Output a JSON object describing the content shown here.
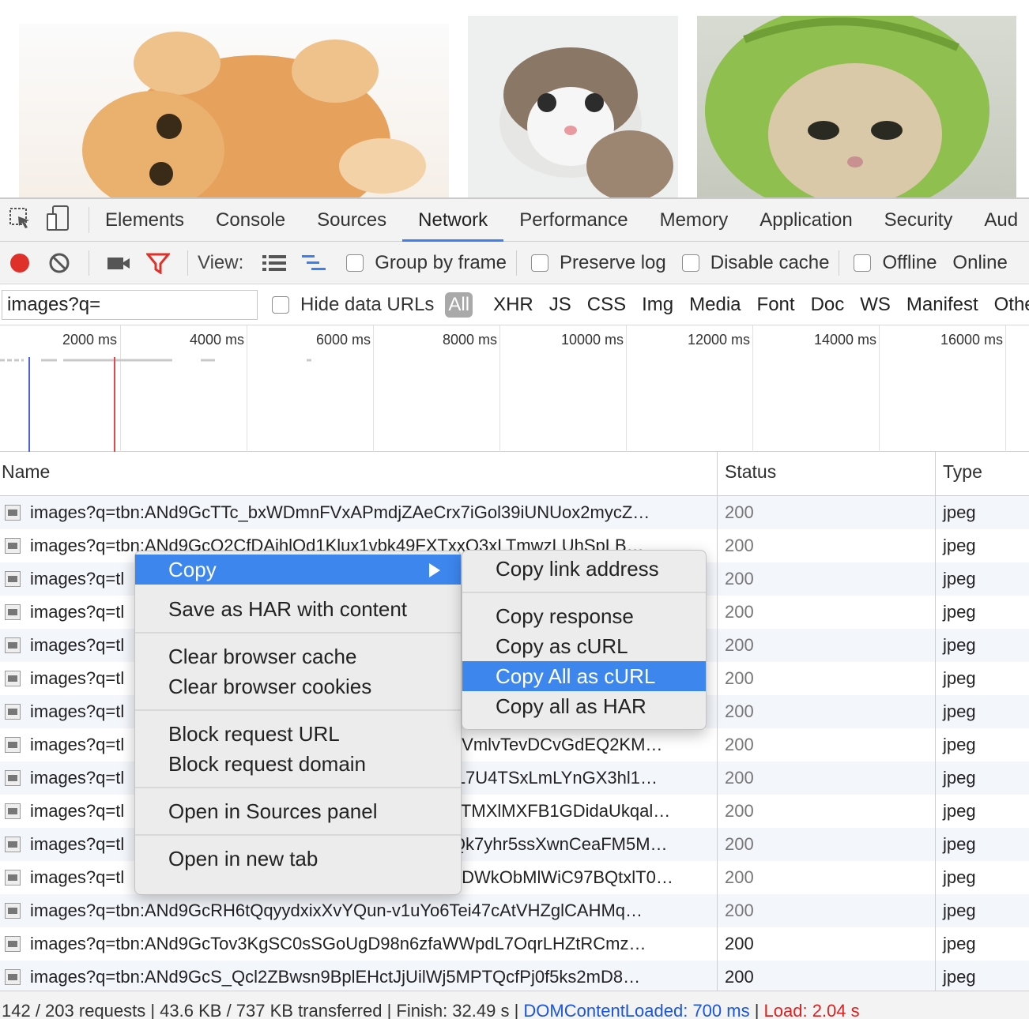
{
  "devtools": {
    "tabs": [
      "Elements",
      "Console",
      "Sources",
      "Network",
      "Performance",
      "Memory",
      "Application",
      "Security",
      "Aud"
    ],
    "active_tab": "Network"
  },
  "toolbar": {
    "view_label": "View:",
    "group_by_frame": "Group by frame",
    "preserve_log": "Preserve log",
    "disable_cache": "Disable cache",
    "offline": "Offline",
    "online": "Online"
  },
  "filter": {
    "value": "images?q=",
    "hide_data_urls": "Hide data URLs",
    "types": [
      "All",
      "XHR",
      "JS",
      "CSS",
      "Img",
      "Media",
      "Font",
      "Doc",
      "WS",
      "Manifest",
      "Othe"
    ]
  },
  "overview": {
    "ticks": [
      "2000 ms",
      "4000 ms",
      "6000 ms",
      "8000 ms",
      "10000 ms",
      "12000 ms",
      "14000 ms",
      "16000 ms"
    ]
  },
  "table": {
    "headers": {
      "name": "Name",
      "status": "Status",
      "type": "Type"
    },
    "rows": [
      {
        "name": "images?q=tbn:ANd9GcTTc_bxWDmnFVxAPmdjZAeCrx7iGol39iUNUox2mycZ…",
        "status": "200",
        "type": "jpeg"
      },
      {
        "name": "images?q=tbn:ANd9GcQ2CfDAjhlOd1Klux1vbk49FXTxxQ3xLTmwzLUhSpLB…",
        "status": "200",
        "type": "jpeg"
      },
      {
        "name": "images?q=tl",
        "status": "200",
        "type": "jpeg"
      },
      {
        "name": "images?q=tl",
        "status": "200",
        "type": "jpeg"
      },
      {
        "name": "images?q=tl",
        "status": "200",
        "type": "jpeg"
      },
      {
        "name": "images?q=tl",
        "status": "200",
        "type": "jpeg"
      },
      {
        "name": "images?q=tl",
        "status": "200",
        "type": "jpeg"
      },
      {
        "name": "images?q=tl",
        "tail": "A3VmlvTevDCvGdEQ2KM…",
        "status": "200",
        "type": "jpeg"
      },
      {
        "name": "images?q=tl",
        "tail": "jAL7U4TSxLmLYnGX3hl1…",
        "status": "200",
        "type": "jpeg"
      },
      {
        "name": "images?q=tl",
        "tail": "nZTMXlMXFB1GDidaUkqal…",
        "status": "200",
        "type": "jpeg"
      },
      {
        "name": "images?q=tl",
        "tail": "AQk7yhr5ssXwnCeaFM5M…",
        "status": "200",
        "type": "jpeg"
      },
      {
        "name": "images?q=tl",
        "tail": "NvDWkObMlWiC97BQtxlT0…",
        "status": "200",
        "type": "jpeg"
      },
      {
        "name": "images?q=tbn:ANd9GcRH6tQqyydxixXvYQun-v1uYo6Tei47cAtVHZglCAHMq…",
        "status": "200",
        "type": "jpeg"
      },
      {
        "name": "images?q=tbn:ANd9GcTov3KgSC0sSGoUgD98n6zfaWWpdL7OqrLHZtRCmz…",
        "status": "200",
        "type": "jpeg"
      },
      {
        "name": "images?q=tbn:ANd9GcS_Qcl2ZBwsn9BplEHctJjUilWj5MPTQcfPj0f5ks2mD8…",
        "status": "200",
        "type": "jpeg"
      }
    ]
  },
  "statusbar": {
    "summary": "142 / 203 requests | 43.6 KB / 737 KB transferred | Finish: 32.49 s | ",
    "dcl": "DOMContentLoaded: 700 ms",
    "divider": " | ",
    "load": "Load: 2.04 s"
  },
  "context_menu": {
    "copy": "Copy",
    "save_har": "Save as HAR with content",
    "clear_cache": "Clear browser cache",
    "clear_cookies": "Clear browser cookies",
    "block_url": "Block request URL",
    "block_domain": "Block request domain",
    "open_sources": "Open in Sources panel",
    "open_tab": "Open in new tab"
  },
  "copy_submenu": {
    "copy_link": "Copy link address",
    "copy_response": "Copy response",
    "copy_curl": "Copy as cURL",
    "copy_all_curl": "Copy All as cURL",
    "copy_all_har": "Copy all as HAR"
  },
  "colors": {
    "accent": "#3d86ee",
    "record": "#e0302a",
    "filter_icon": "#e0302a",
    "dcl": "#1a55e0",
    "load": "#e02020"
  }
}
